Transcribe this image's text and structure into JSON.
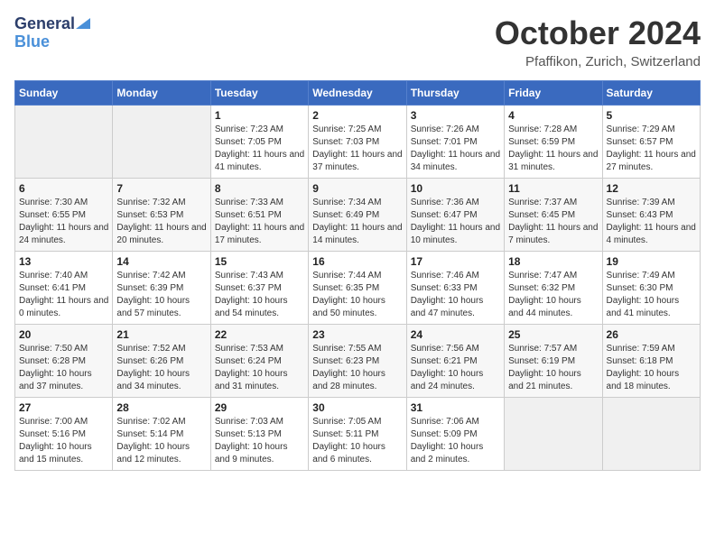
{
  "header": {
    "logo_general": "General",
    "logo_blue": "Blue",
    "month": "October 2024",
    "location": "Pfaffikon, Zurich, Switzerland"
  },
  "weekdays": [
    "Sunday",
    "Monday",
    "Tuesday",
    "Wednesday",
    "Thursday",
    "Friday",
    "Saturday"
  ],
  "weeks": [
    [
      {
        "day": "",
        "info": ""
      },
      {
        "day": "",
        "info": ""
      },
      {
        "day": "1",
        "info": "Sunrise: 7:23 AM\nSunset: 7:05 PM\nDaylight: 11 hours and 41 minutes."
      },
      {
        "day": "2",
        "info": "Sunrise: 7:25 AM\nSunset: 7:03 PM\nDaylight: 11 hours and 37 minutes."
      },
      {
        "day": "3",
        "info": "Sunrise: 7:26 AM\nSunset: 7:01 PM\nDaylight: 11 hours and 34 minutes."
      },
      {
        "day": "4",
        "info": "Sunrise: 7:28 AM\nSunset: 6:59 PM\nDaylight: 11 hours and 31 minutes."
      },
      {
        "day": "5",
        "info": "Sunrise: 7:29 AM\nSunset: 6:57 PM\nDaylight: 11 hours and 27 minutes."
      }
    ],
    [
      {
        "day": "6",
        "info": "Sunrise: 7:30 AM\nSunset: 6:55 PM\nDaylight: 11 hours and 24 minutes."
      },
      {
        "day": "7",
        "info": "Sunrise: 7:32 AM\nSunset: 6:53 PM\nDaylight: 11 hours and 20 minutes."
      },
      {
        "day": "8",
        "info": "Sunrise: 7:33 AM\nSunset: 6:51 PM\nDaylight: 11 hours and 17 minutes."
      },
      {
        "day": "9",
        "info": "Sunrise: 7:34 AM\nSunset: 6:49 PM\nDaylight: 11 hours and 14 minutes."
      },
      {
        "day": "10",
        "info": "Sunrise: 7:36 AM\nSunset: 6:47 PM\nDaylight: 11 hours and 10 minutes."
      },
      {
        "day": "11",
        "info": "Sunrise: 7:37 AM\nSunset: 6:45 PM\nDaylight: 11 hours and 7 minutes."
      },
      {
        "day": "12",
        "info": "Sunrise: 7:39 AM\nSunset: 6:43 PM\nDaylight: 11 hours and 4 minutes."
      }
    ],
    [
      {
        "day": "13",
        "info": "Sunrise: 7:40 AM\nSunset: 6:41 PM\nDaylight: 11 hours and 0 minutes."
      },
      {
        "day": "14",
        "info": "Sunrise: 7:42 AM\nSunset: 6:39 PM\nDaylight: 10 hours and 57 minutes."
      },
      {
        "day": "15",
        "info": "Sunrise: 7:43 AM\nSunset: 6:37 PM\nDaylight: 10 hours and 54 minutes."
      },
      {
        "day": "16",
        "info": "Sunrise: 7:44 AM\nSunset: 6:35 PM\nDaylight: 10 hours and 50 minutes."
      },
      {
        "day": "17",
        "info": "Sunrise: 7:46 AM\nSunset: 6:33 PM\nDaylight: 10 hours and 47 minutes."
      },
      {
        "day": "18",
        "info": "Sunrise: 7:47 AM\nSunset: 6:32 PM\nDaylight: 10 hours and 44 minutes."
      },
      {
        "day": "19",
        "info": "Sunrise: 7:49 AM\nSunset: 6:30 PM\nDaylight: 10 hours and 41 minutes."
      }
    ],
    [
      {
        "day": "20",
        "info": "Sunrise: 7:50 AM\nSunset: 6:28 PM\nDaylight: 10 hours and 37 minutes."
      },
      {
        "day": "21",
        "info": "Sunrise: 7:52 AM\nSunset: 6:26 PM\nDaylight: 10 hours and 34 minutes."
      },
      {
        "day": "22",
        "info": "Sunrise: 7:53 AM\nSunset: 6:24 PM\nDaylight: 10 hours and 31 minutes."
      },
      {
        "day": "23",
        "info": "Sunrise: 7:55 AM\nSunset: 6:23 PM\nDaylight: 10 hours and 28 minutes."
      },
      {
        "day": "24",
        "info": "Sunrise: 7:56 AM\nSunset: 6:21 PM\nDaylight: 10 hours and 24 minutes."
      },
      {
        "day": "25",
        "info": "Sunrise: 7:57 AM\nSunset: 6:19 PM\nDaylight: 10 hours and 21 minutes."
      },
      {
        "day": "26",
        "info": "Sunrise: 7:59 AM\nSunset: 6:18 PM\nDaylight: 10 hours and 18 minutes."
      }
    ],
    [
      {
        "day": "27",
        "info": "Sunrise: 7:00 AM\nSunset: 5:16 PM\nDaylight: 10 hours and 15 minutes."
      },
      {
        "day": "28",
        "info": "Sunrise: 7:02 AM\nSunset: 5:14 PM\nDaylight: 10 hours and 12 minutes."
      },
      {
        "day": "29",
        "info": "Sunrise: 7:03 AM\nSunset: 5:13 PM\nDaylight: 10 hours and 9 minutes."
      },
      {
        "day": "30",
        "info": "Sunrise: 7:05 AM\nSunset: 5:11 PM\nDaylight: 10 hours and 6 minutes."
      },
      {
        "day": "31",
        "info": "Sunrise: 7:06 AM\nSunset: 5:09 PM\nDaylight: 10 hours and 2 minutes."
      },
      {
        "day": "",
        "info": ""
      },
      {
        "day": "",
        "info": ""
      }
    ]
  ]
}
